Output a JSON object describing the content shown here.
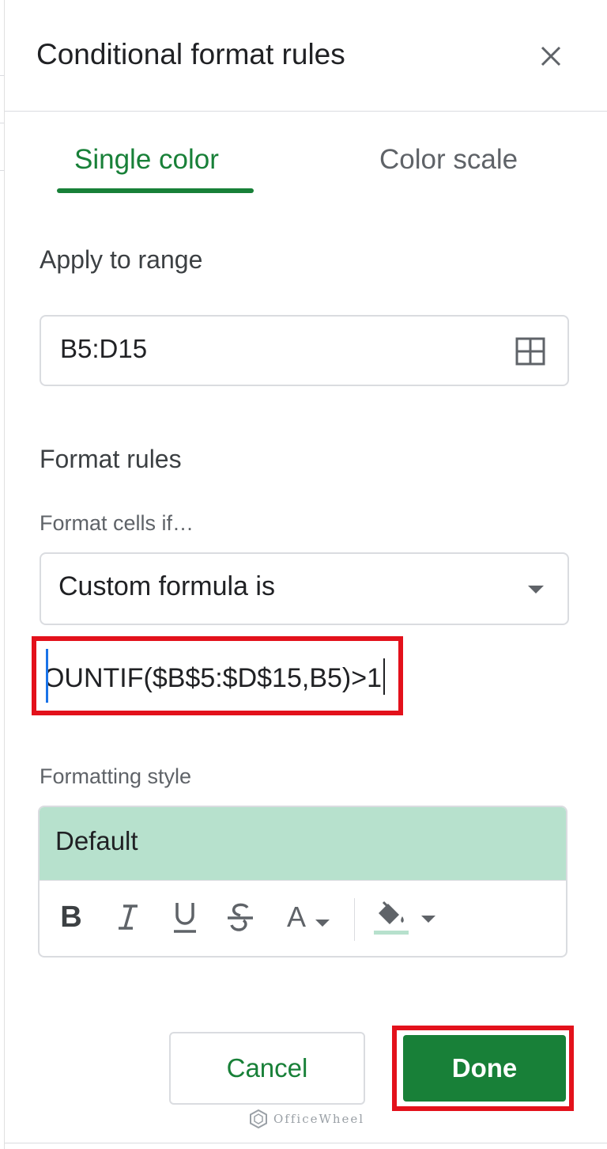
{
  "panel": {
    "title": "Conditional format rules",
    "close_icon": "close-icon"
  },
  "tabs": [
    {
      "label": "Single color",
      "active": true
    },
    {
      "label": "Color scale",
      "active": false
    }
  ],
  "apply_range": {
    "heading": "Apply to range",
    "value": "B5:D15",
    "icon": "select-range-grid-icon"
  },
  "format_rules": {
    "heading": "Format rules",
    "condition_label": "Format cells if…",
    "condition_value": "Custom formula is",
    "formula_value": "OUNTIF($B$5:$D$15,B5)>1"
  },
  "formatting_style": {
    "label": "Formatting style",
    "preset": "Default",
    "preview_color": "#b7e1cd",
    "toolbar": {
      "bold": "B",
      "italic": "I",
      "underline": "U",
      "strikethrough": "S",
      "text_color": "A"
    }
  },
  "actions": {
    "cancel": "Cancel",
    "done": "Done"
  },
  "colors": {
    "accent_green": "#188038",
    "highlight_red": "#e3111b",
    "border_gray": "#dadce0"
  },
  "watermark": "OfficeWheel"
}
